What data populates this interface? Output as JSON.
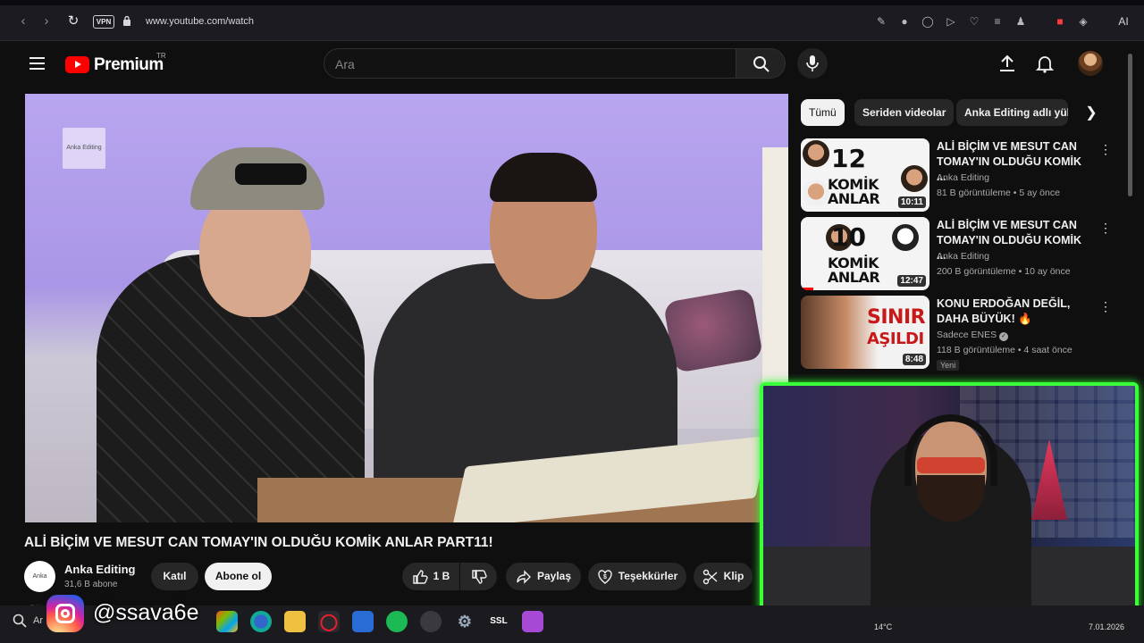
{
  "browser": {
    "url": "www.youtube.com/watch",
    "vpn_label": "VPN",
    "ai_label": "AI"
  },
  "header": {
    "logo_text": "Premium",
    "region": "TR",
    "search_placeholder": "Ara"
  },
  "player": {
    "watermark": "Anka Editing"
  },
  "video": {
    "title": "ALİ BİÇİM VE MESUT CAN TOMAY'IN OLDUĞU KOMİK ANLAR PART11!",
    "channel_name": "Anka Editing",
    "channel_avatar_text": "Anka Editing",
    "subscribers": "31,6 B abone",
    "join_label": "Katıl",
    "subscribe_label": "Abone ol",
    "like_count": "1 B",
    "share_label": "Paylaş",
    "thanks_label": "Teşekkürler",
    "clip_label": "Klip"
  },
  "chips": [
    {
      "label": "Tümü",
      "active": true
    },
    {
      "label": "Seriden videolar",
      "active": false
    },
    {
      "label": "Anka Editing adlı yükl",
      "active": false
    }
  ],
  "recommendations": [
    {
      "title": "ALİ BİÇİM VE MESUT CAN TOMAY'IN OLDUĞU KOMİK ...",
      "channel": "Anka Editing",
      "meta": "81 B görüntüleme • 5 ay önce",
      "duration": "10:11",
      "thumb_number": "12",
      "thumb_word1": "KOMİK",
      "thumb_word2": "ANLAR"
    },
    {
      "title": "ALİ BİÇİM VE MESUT CAN TOMAY'IN OLDUĞU KOMİK ...",
      "channel": "Anka Editing",
      "meta": "200 B görüntüleme • 10 ay önce",
      "duration": "12:47",
      "thumb_number": "10",
      "thumb_word1": "KOMİK",
      "thumb_word2": "ANLAR",
      "progress": 0.1
    },
    {
      "title": "KONU ERDOĞAN DEĞİL, DAHA BÜYÜK! 🔥",
      "channel": "Sadece ENES",
      "meta": "118 B görüntüleme • 4 saat önce",
      "duration": "8:48",
      "thumb_word1": "SINIR",
      "thumb_word2": "AŞILDI",
      "badge": "Yeni"
    }
  ],
  "overlay": {
    "instagram_handle": "@ssava6e"
  },
  "taskbar": {
    "search_text": "Ar",
    "temperature": "14°C",
    "date": "7.01.2026",
    "ssl_label": "SSL"
  }
}
